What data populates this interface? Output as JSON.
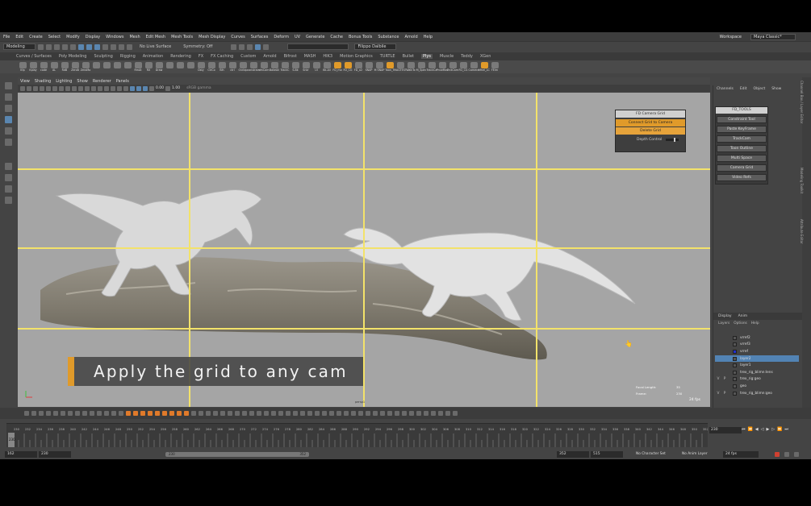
{
  "menubar": {
    "items": [
      "File",
      "Edit",
      "Create",
      "Select",
      "Modify",
      "Display",
      "Windows",
      "Mesh",
      "Edit Mesh",
      "Mesh Tools",
      "Mesh Display",
      "Curves",
      "Surfaces",
      "Deform",
      "UV",
      "Generate",
      "Cache",
      "Bonus Tools",
      "Substance",
      "Arnold",
      "Help"
    ],
    "workspace_label": "Workspace",
    "workspace_value": "Maya Classic*"
  },
  "statusline": {
    "mode": "Modeling",
    "live_surface": "No Live Surface",
    "symmetry": "Symmetry: Off",
    "user": "Filippo Dalbile"
  },
  "shelf_tabs": [
    "Curves / Surfaces",
    "Poly Modeling",
    "Sculpting",
    "Rigging",
    "Animation",
    "Rendering",
    "FX",
    "FX Caching",
    "Custom",
    "Arnold",
    "Bifrost",
    "MASH",
    "HIK3",
    "Motion Graphics",
    "TURTLE",
    "Bullet",
    "Plys",
    "Muscle",
    "Teddy",
    "XGen"
  ],
  "shelf_active_tab": "Plys",
  "shelf_tools": [
    "Kfp",
    "Kplay",
    "code",
    "AL",
    "RdB",
    "ZeroB",
    "ZeroMo",
    "",
    "",
    "",
    "",
    "RmAt",
    "RX",
    "Draw",
    "",
    "",
    "",
    "Dsty",
    "CtrCo",
    "Blh",
    "ctrl",
    "Ovrlap",
    "constrain",
    "dmCam",
    "BakeAll",
    "TrackC",
    "S-Bk",
    "Snkr",
    "UI",
    "Bk-All",
    "FD_mo",
    "FD_CG",
    "FD_o2",
    "SNAP",
    "M SNAP",
    "Toon_T",
    "MAGTEST",
    "WalkTo",
    "M_Spec",
    "TrackCa",
    "PrvwMos",
    "TrckCam",
    "FD_CG",
    "Camera",
    "Mhel_LC",
    "FEIm"
  ],
  "viewport_menu": [
    "View",
    "Shading",
    "Lighting",
    "Show",
    "Renderer",
    "Panels"
  ],
  "viewport_fields": {
    "near": "0.00",
    "scale": "1.00",
    "colorspace": "sRGB gamma"
  },
  "camera_grid_window": {
    "title": "FD Camera Grid",
    "connect_label": "Connect Grid to Camera",
    "delete_label": "Delete Grid",
    "depth_label": "Depth Control"
  },
  "caption": "Apply the grid to any cam",
  "hud": {
    "focal_label": "Focal Length:",
    "focal_value": "35",
    "frame_label": "Frame:",
    "frame_value": "230",
    "fps": "24 fps",
    "camera_label": "persp1"
  },
  "channel_box": {
    "menu": [
      "Channels",
      "Edit",
      "Object",
      "Show"
    ],
    "fd_tools_title": "FD_TOOLS",
    "fd_tools_buttons": [
      "Constraint Tool",
      "Paste KeyFrame",
      "TrackCam",
      "Toon Outline",
      "Multi Space",
      "Camera Grid",
      "Video Refs"
    ]
  },
  "right_sidebar": [
    "Channel Box / Layer Editor",
    "Modeling Toolkit",
    "Attribute Editor"
  ],
  "layer_editor": {
    "tabs": [
      "Display",
      "Anim"
    ],
    "sub_menu": [
      "Layers",
      "Options",
      "Help"
    ],
    "layers": [
      {
        "v": "",
        "p": "",
        "name": "vrref2"
      },
      {
        "v": "",
        "p": "",
        "name": "vrref3"
      },
      {
        "v": "",
        "p": "",
        "name": "vrref"
      },
      {
        "v": "",
        "p": "",
        "name": "layer2",
        "selected": true
      },
      {
        "v": "",
        "p": "",
        "name": "layer1"
      },
      {
        "v": "",
        "p": "",
        "name": "trex_rig_blimn:lens"
      },
      {
        "v": "V",
        "p": "P",
        "name": "trex_rig:geo"
      },
      {
        "v": "",
        "p": "",
        "name": "geo"
      },
      {
        "v": "V",
        "p": "P",
        "name": "trex_rig_blimn:geo"
      }
    ]
  },
  "timeline": {
    "current_frame": "230",
    "ticks": [
      "230",
      "232",
      "234",
      "236",
      "238",
      "240",
      "242",
      "244",
      "246",
      "248",
      "250",
      "252",
      "254",
      "256",
      "258",
      "260",
      "262",
      "264",
      "266",
      "268",
      "270",
      "272",
      "274",
      "276",
      "278",
      "280",
      "282",
      "284",
      "286",
      "288",
      "290",
      "292",
      "294",
      "296",
      "298",
      "300",
      "302",
      "304",
      "306",
      "308",
      "310",
      "312",
      "314",
      "316",
      "318",
      "320",
      "322",
      "324",
      "326",
      "328",
      "330",
      "332",
      "334",
      "336",
      "338",
      "340",
      "342",
      "344",
      "346",
      "348",
      "350",
      "352"
    ],
    "playback_field": "230"
  },
  "range": {
    "start": "162",
    "anim_start": "230",
    "slider_start": "230",
    "slider_end": "352",
    "anim_end": "352",
    "end": "515",
    "character_set": "No Character Set",
    "anim_layer": "No Anim Layer",
    "fps": "24 fps"
  }
}
